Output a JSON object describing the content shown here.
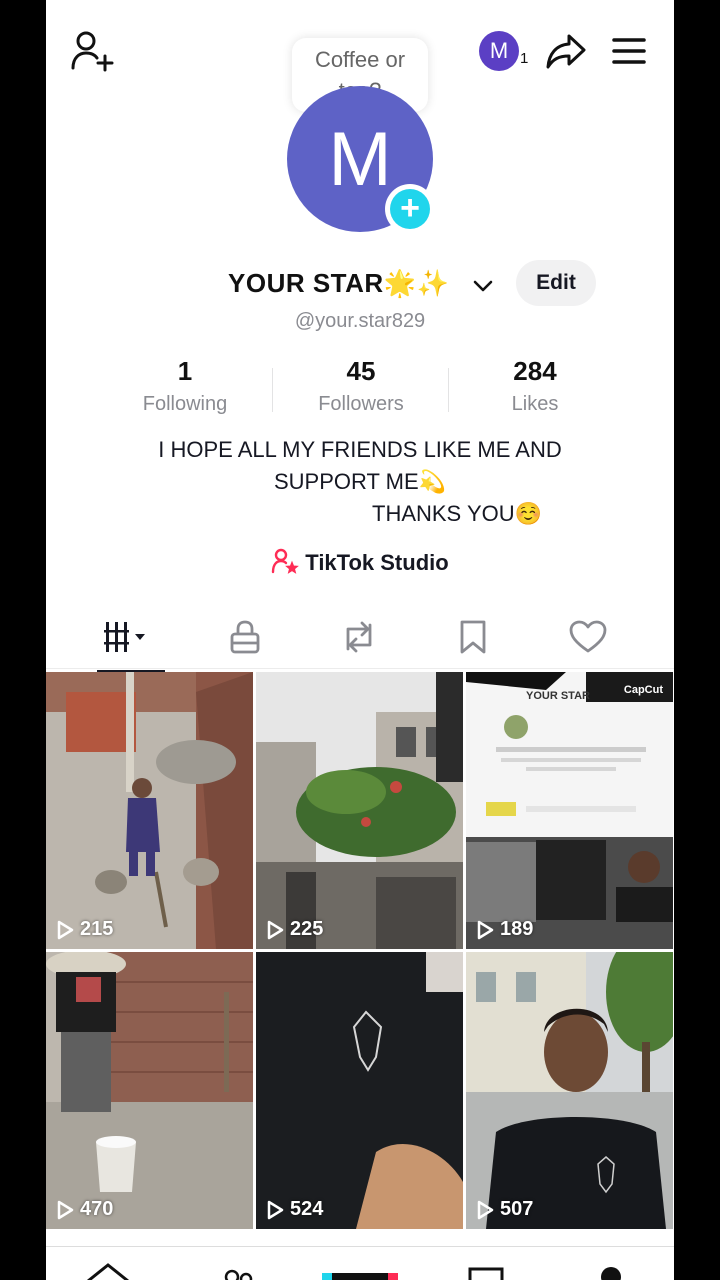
{
  "top_bar": {
    "bubble_line1": "Coffee or",
    "bubble_line2": "tea?",
    "mini_avatar_letter": "M",
    "notification_count": "1"
  },
  "profile": {
    "avatar_letter": "M",
    "display_name": "YOUR STAR🌟✨",
    "edit_label": "Edit",
    "handle": "@your.star829"
  },
  "stats": {
    "following_count": "1",
    "following_label": "Following",
    "followers_count": "45",
    "followers_label": "Followers",
    "likes_count": "284",
    "likes_label": "Likes"
  },
  "bio": {
    "line1": "I HOPE ALL MY FRIENDS LIKE ME AND",
    "line2": "SUPPORT ME💫",
    "line3": "THANKS YOU☺️"
  },
  "studio_label": "TikTok Studio",
  "tabs": [
    "videos-grid",
    "private-lock",
    "reposts",
    "saved-bookmark",
    "liked-heart"
  ],
  "videos": [
    {
      "views": "215"
    },
    {
      "views": "225"
    },
    {
      "views": "189",
      "watermark": "CapCut",
      "thumb_text": "YOUR STAR"
    },
    {
      "views": "470"
    },
    {
      "views": "524"
    },
    {
      "views": "507"
    }
  ],
  "colors": {
    "avatar": "#5e62c6",
    "accent_plus": "#20d5ec",
    "studio_pink": "#fe2c55"
  }
}
